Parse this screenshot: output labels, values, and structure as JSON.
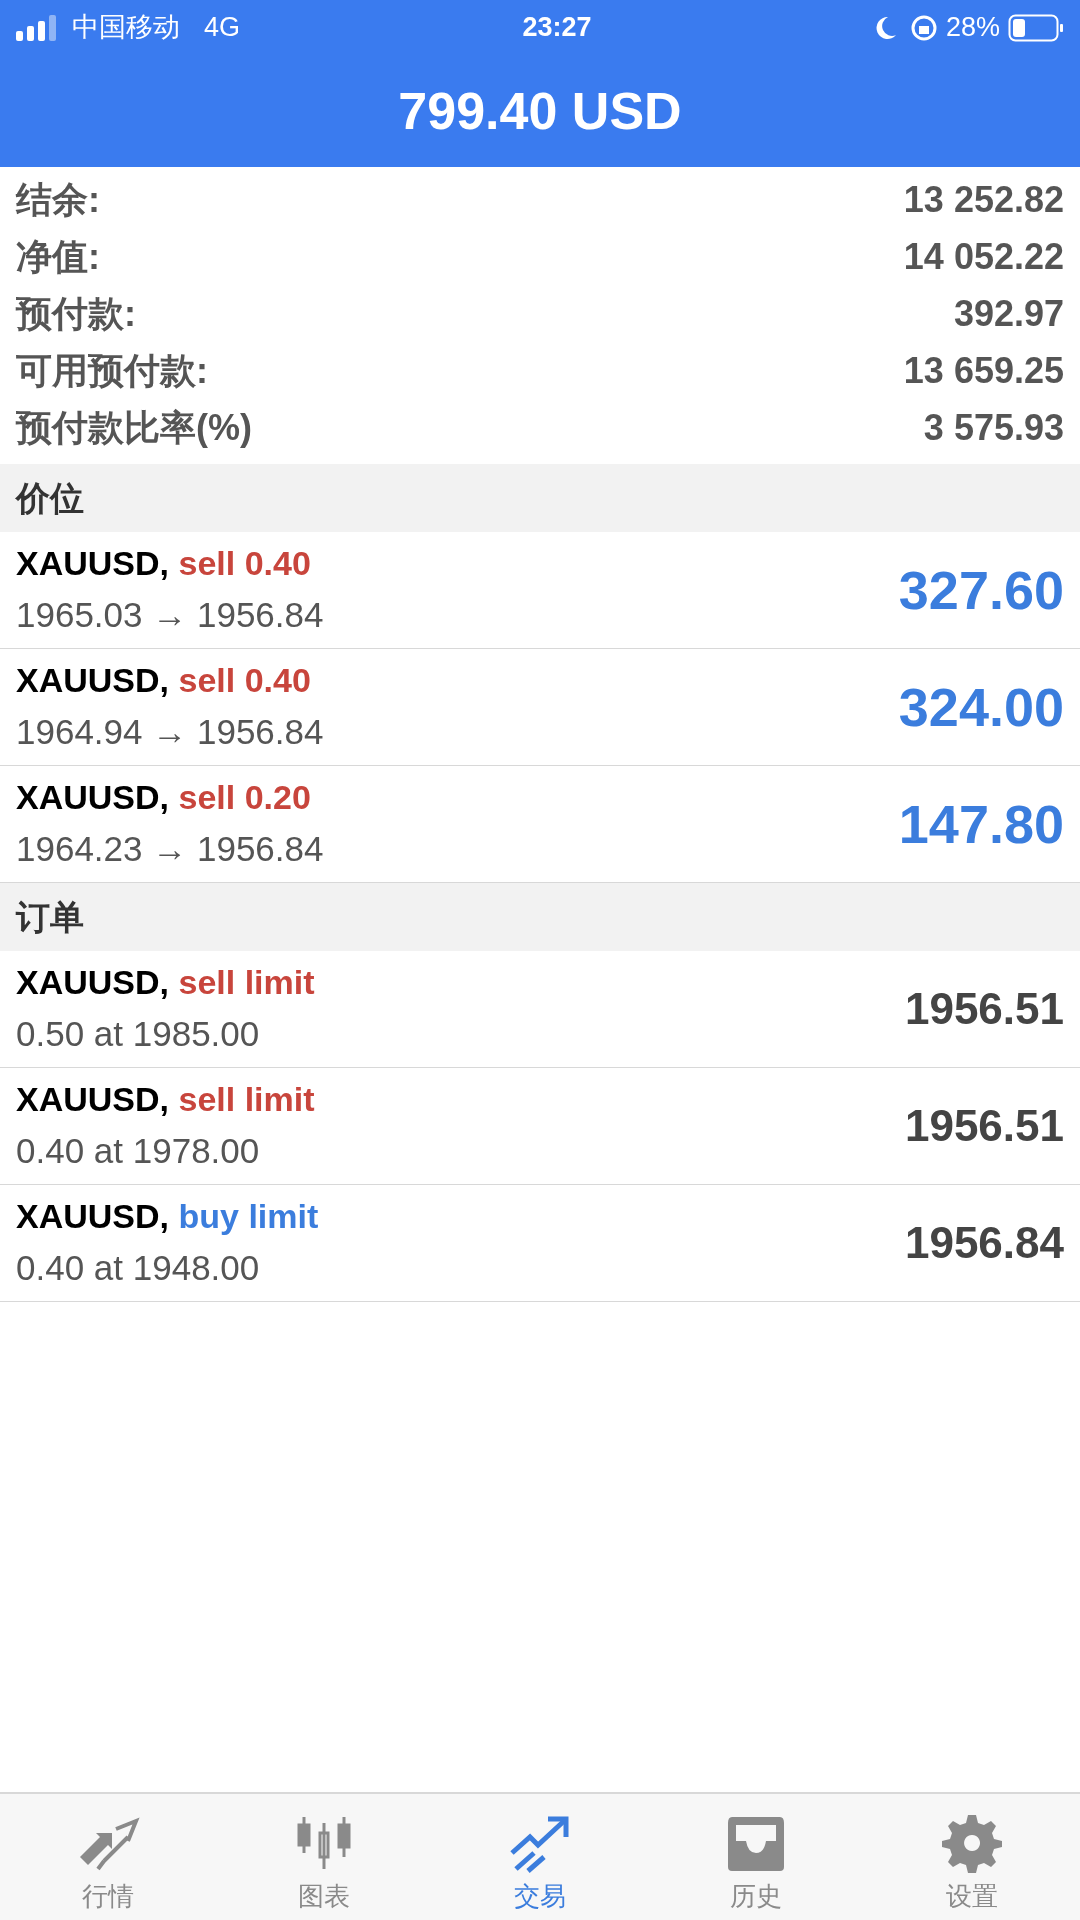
{
  "status_bar": {
    "carrier": "中国移动",
    "network": "4G",
    "time": "23:27",
    "battery": "28%"
  },
  "header": {
    "title": "799.40 USD"
  },
  "summary": [
    {
      "label": "结余:",
      "value": "13 252.82"
    },
    {
      "label": "净值:",
      "value": "14 052.22"
    },
    {
      "label": "预付款:",
      "value": "392.97"
    },
    {
      "label": "可用预付款:",
      "value": "13 659.25"
    },
    {
      "label": "预付款比率(%)",
      "value": "3 575.93"
    }
  ],
  "positions_section": {
    "title": "价位"
  },
  "positions": [
    {
      "symbol": "XAUUSD,",
      "color": "#c8453c",
      "order": "sell 0.40",
      "prices": "1965.03 → 1956.84",
      "profit": "327.60"
    },
    {
      "symbol": "XAUUSD,",
      "color": "#c8453c",
      "order": "sell 0.40",
      "prices": "1964.94 → 1956.84",
      "profit": "324.00"
    },
    {
      "symbol": "XAUUSD,",
      "color": "#c8453c",
      "order": "sell 0.20",
      "prices": "1964.23 → 1956.84",
      "profit": "147.80"
    }
  ],
  "orders_section": {
    "title": "订单"
  },
  "orders": [
    {
      "symbol": "XAUUSD,",
      "color": "#c8453c",
      "order": "sell limit",
      "detail": "0.50 at 1985.00",
      "price": "1956.51"
    },
    {
      "symbol": "XAUUSD,",
      "color": "#c8453c",
      "order": "sell limit",
      "detail": "0.40 at 1978.00",
      "price": "1956.51"
    },
    {
      "symbol": "XAUUSD,",
      "color": "#3b7ddd",
      "order": "buy limit",
      "detail": "0.40 at 1948.00",
      "price": "1956.84"
    }
  ],
  "tab_bar": [
    {
      "kind": "quotes",
      "label": "行情",
      "selected": false
    },
    {
      "kind": "chart",
      "label": "图表",
      "selected": false
    },
    {
      "kind": "trade",
      "label": "交易",
      "selected": true
    },
    {
      "kind": "history",
      "label": "历史",
      "selected": false
    },
    {
      "kind": "settings",
      "label": "设置",
      "selected": false
    }
  ]
}
